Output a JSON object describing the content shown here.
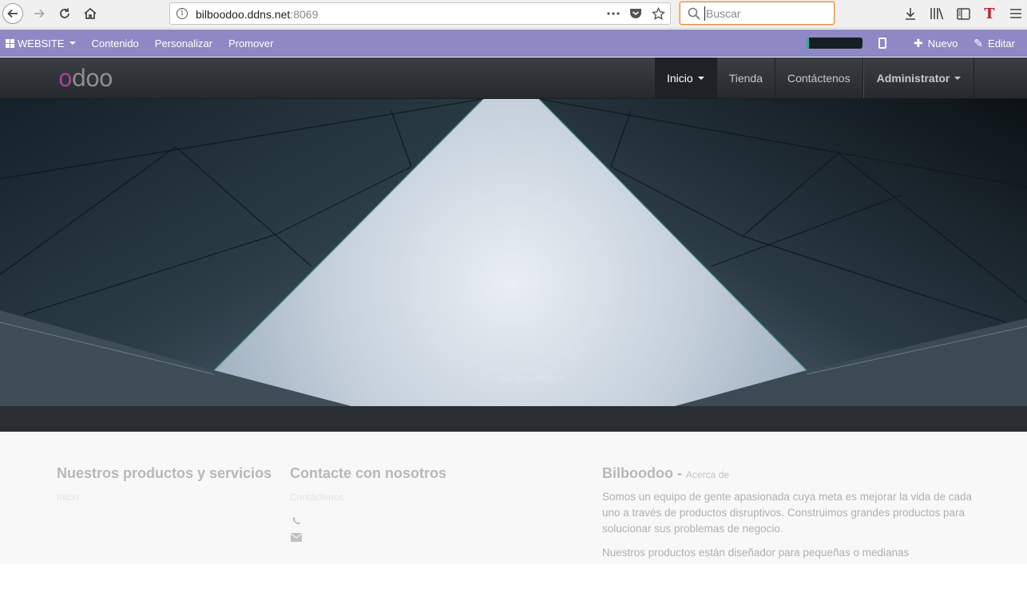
{
  "browser": {
    "url_host": "bilboodoo.ddns.net",
    "url_port": ":8069",
    "search_placeholder": "Buscar"
  },
  "admin_bar": {
    "website_label": "WEBSITE",
    "items": [
      "Contenido",
      "Personalizar",
      "Promover"
    ],
    "new_label": "Nuevo",
    "edit_label": "Editar",
    "progress_fraction": 0.05
  },
  "navbar": {
    "logo": "odoo",
    "menu": [
      "Inicio",
      "Tienda",
      "Contáctenos"
    ],
    "user": "Administrator"
  },
  "hero": {
    "caption": "de desarrollo •"
  },
  "footer": {
    "products_title": "Nuestros productos y servicios",
    "products_link": "Inicio",
    "contact_title": "Contacte con nosotros",
    "contact_link": "Contáctenos",
    "about_title": "Bilboodoo",
    "about_sep": " - ",
    "about_sub": "Acerca de",
    "about_p1": "Somos un equipo de gente apasionada cuya meta es mejorar la vida de cada uno a través de productos disruptivos. Construimos grandes productos para solucionar sus problemas de negocio.",
    "about_p2": "Nuestros productos están diseñador para pequeñas o medianas"
  },
  "colors": {
    "admin_bar": "#8e89c4",
    "navbar": "#2f3236",
    "logo_accent": "#a24689",
    "footer_bg": "#f8f8f8"
  }
}
